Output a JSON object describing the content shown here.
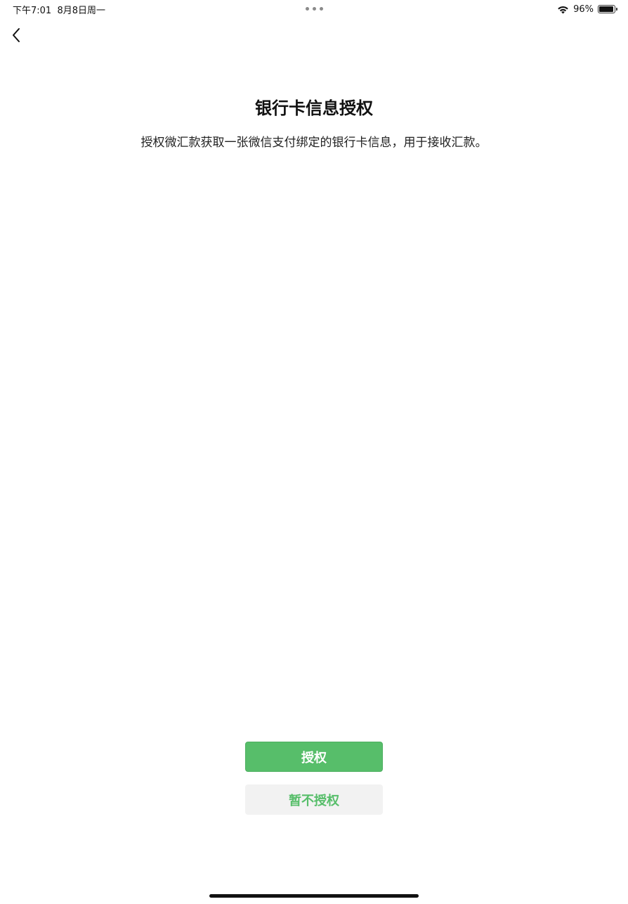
{
  "status_bar": {
    "time": "下午7:01",
    "date": "8月8日周一",
    "battery_percent": "96%",
    "battery_level": 0.96
  },
  "nav": {
    "back_icon": "chevron-left-icon"
  },
  "page": {
    "title": "银行卡信息授权",
    "description": "授权微汇款获取一张微信支付绑定的银行卡信息，用于接收汇款。"
  },
  "actions": {
    "authorize_label": "授权",
    "decline_label": "暂不授权"
  },
  "colors": {
    "accent": "#57be6a",
    "secondary_bg": "#f2f2f2"
  }
}
